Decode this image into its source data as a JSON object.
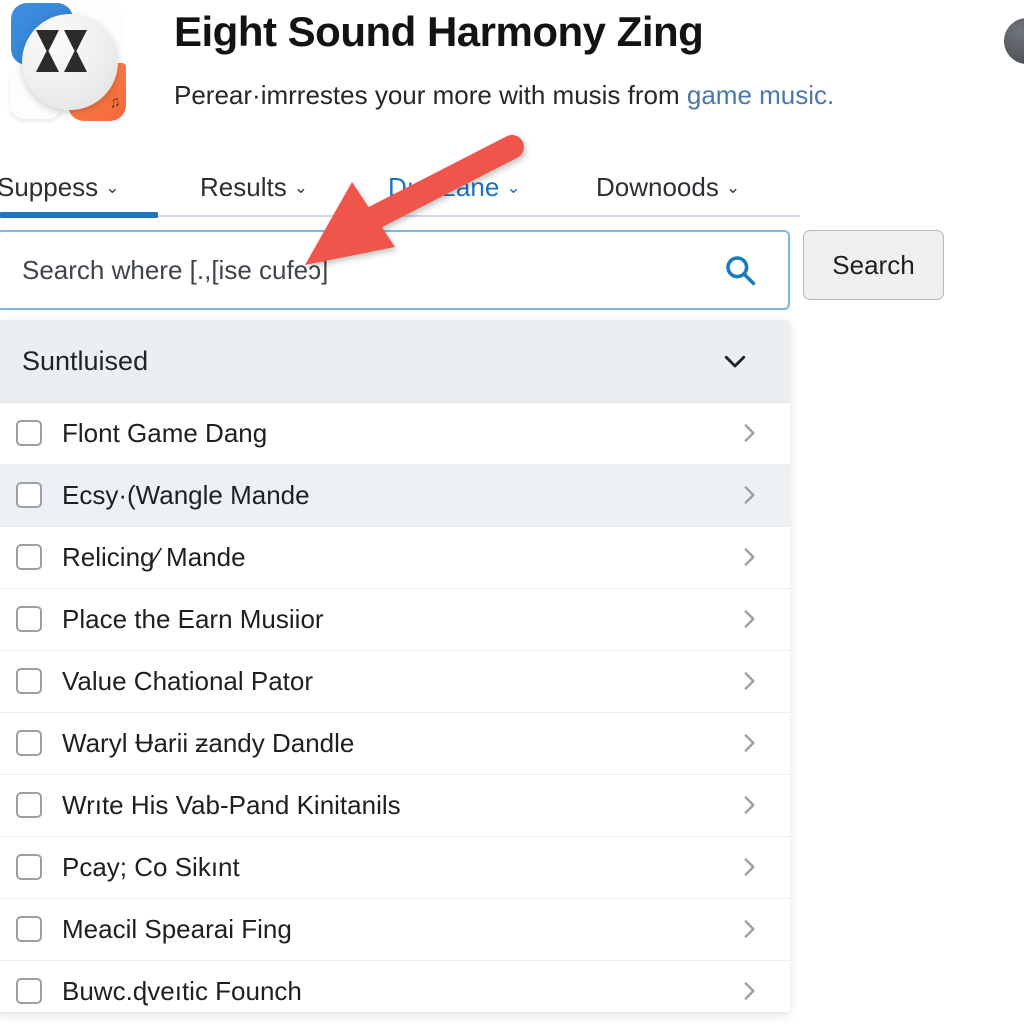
{
  "header": {
    "title": "Eight Sound Harmony Zing",
    "subtitle_prefix": "Perear·imrrestes your more with musis from ",
    "subtitle_link": "game music.",
    "app_icon_name": "app-logo-icon",
    "icon_blue_glyph": "♪",
    "icon_orange_glyph": "♫",
    "avatar_name": "user-avatar"
  },
  "nav": {
    "tabs": [
      {
        "label": "Suppess",
        "chevron": "⌄",
        "active": true
      },
      {
        "label": "Results",
        "chevron": "⌄",
        "active": false
      },
      {
        "label": "Dıpezane",
        "chevron": "⌄",
        "active": false
      },
      {
        "label": "Downoods",
        "chevron": "⌄",
        "active": false
      }
    ]
  },
  "search": {
    "placeholder": "Search where [.,[ise cufeɔ]",
    "value": "",
    "icon": "search-icon",
    "button_label": "Search"
  },
  "panel": {
    "section_title": "Suntluised",
    "section_chevron": "chevron-down-icon",
    "rows": [
      {
        "label": "Flont Game Dang",
        "checked": false,
        "highlighted": false
      },
      {
        "label": "Ecsy·(Wangle Mande",
        "checked": false,
        "highlighted": true
      },
      {
        "label": "Relicinɡ⁄ Mande",
        "checked": false,
        "highlighted": false
      },
      {
        "label": "Place the Earn Musiior",
        "checked": false,
        "highlighted": false
      },
      {
        "label": "Value Chational Pator",
        "checked": false,
        "highlighted": false
      },
      {
        "label": "Waryl Ʉarii ƶandy Dandle",
        "checked": false,
        "highlighted": false
      },
      {
        "label": "Wrıte His Vab-Pand Kinitanils",
        "checked": false,
        "highlighted": false
      },
      {
        "label": "Pcay; Co Sikınt",
        "checked": false,
        "highlighted": false
      },
      {
        "label": "Meacil Spearai Fing",
        "checked": false,
        "highlighted": false
      },
      {
        "label": "Buwc.ɖveıtic Founch",
        "checked": false,
        "highlighted": false
      }
    ]
  },
  "annotation": {
    "arrow_name": "red-pointer-arrow",
    "arrow_color": "#f0554b",
    "points_to": "search-input"
  },
  "colors": {
    "accent_blue": "#1f74ba",
    "link_blue": "#4a78a8",
    "tab_blue": "#1a73c0",
    "search_border": "#7fb6e8",
    "panel_header_bg": "#eceff1",
    "row_highlight_bg": "#edf1f5",
    "arrow_red": "#f0554b"
  }
}
